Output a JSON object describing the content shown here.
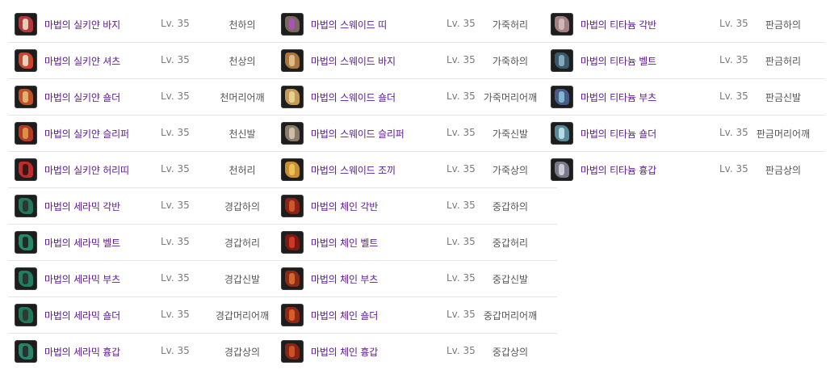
{
  "columns": [
    {
      "items": [
        {
          "name": "마법의 실키얀 바지",
          "level": "Lv. 35",
          "type": "천하의",
          "icon": "silk-pants-icon",
          "color": "#b8353a",
          "accent": "#f0e4d0"
        },
        {
          "name": "마법의 실키얀 셔츠",
          "level": "Lv. 35",
          "type": "천상의",
          "icon": "silk-shirt-icon",
          "color": "#c8462e",
          "accent": "#f1e7d6"
        },
        {
          "name": "마법의 실키얀 숄더",
          "level": "Lv. 35",
          "type": "천머리어깨",
          "icon": "silk-shoulder-icon",
          "color": "#c0502c",
          "accent": "#e9c07a"
        },
        {
          "name": "마법의 실키얀 슬리퍼",
          "level": "Lv. 35",
          "type": "천신발",
          "icon": "silk-slipper-icon",
          "color": "#b43a26",
          "accent": "#e0a050"
        },
        {
          "name": "마법의 실키얀 허리띠",
          "level": "Lv. 35",
          "type": "천허리",
          "icon": "silk-belt-icon",
          "color": "#c22b2b",
          "accent": "#2a1010"
        },
        {
          "name": "마법의 세라믹 각반",
          "level": "Lv. 35",
          "type": "경갑하의",
          "icon": "ceramic-greaves-icon",
          "color": "#1f7a5c",
          "accent": "#2d2d2d"
        },
        {
          "name": "마법의 세라믹 벨트",
          "level": "Lv. 35",
          "type": "경갑허리",
          "icon": "ceramic-belt-icon",
          "color": "#238a68",
          "accent": "#1c1c1c"
        },
        {
          "name": "마법의 세라믹 부츠",
          "level": "Lv. 35",
          "type": "경갑신발",
          "icon": "ceramic-boots-icon",
          "color": "#1f7f60",
          "accent": "#2a2a2a"
        },
        {
          "name": "마법의 세라믹 숄더",
          "level": "Lv. 35",
          "type": "경갑머리어깨",
          "icon": "ceramic-shoulder-icon",
          "color": "#1e7a57",
          "accent": "#303030"
        },
        {
          "name": "마법의 세라믹 흉갑",
          "level": "Lv. 35",
          "type": "경갑상의",
          "icon": "ceramic-breastplate-icon",
          "color": "#25866a",
          "accent": "#262626"
        }
      ]
    },
    {
      "items": [
        {
          "name": "마법의 스웨이드 띠",
          "level": "Lv. 35",
          "type": "가죽허리",
          "icon": "suede-belt-icon",
          "color": "#7a6a5a",
          "accent": "#b050c0"
        },
        {
          "name": "마법의 스웨이드 바지",
          "level": "Lv. 35",
          "type": "가죽하의",
          "icon": "suede-pants-icon",
          "color": "#a8763e",
          "accent": "#e8c890"
        },
        {
          "name": "마법의 스웨이드 숄더",
          "level": "Lv. 35",
          "type": "가죽머리어깨",
          "icon": "suede-shoulder-icon",
          "color": "#c49a55",
          "accent": "#f0d8a0"
        },
        {
          "name": "마법의 스웨이드 슬리퍼",
          "level": "Lv. 35",
          "type": "가죽신발",
          "icon": "suede-slipper-icon",
          "color": "#8a7a6a",
          "accent": "#d8c8b0"
        },
        {
          "name": "마법의 스웨이드 조끼",
          "level": "Lv. 35",
          "type": "가죽상의",
          "icon": "suede-vest-icon",
          "color": "#c8902e",
          "accent": "#f0c860"
        },
        {
          "name": "마법의 체인 각반",
          "level": "Lv. 35",
          "type": "중갑하의",
          "icon": "chain-greaves-icon",
          "color": "#8a2418",
          "accent": "#d86030"
        },
        {
          "name": "마법의 체인 벨트",
          "level": "Lv. 35",
          "type": "중갑허리",
          "icon": "chain-belt-icon",
          "color": "#7a1a14",
          "accent": "#d84028"
        },
        {
          "name": "마법의 체인 부츠",
          "level": "Lv. 35",
          "type": "중갑신발",
          "icon": "chain-boots-icon",
          "color": "#8c2a18",
          "accent": "#e07030"
        },
        {
          "name": "마법의 체인 숄더",
          "level": "Lv. 35",
          "type": "중갑머리어깨",
          "icon": "chain-shoulder-icon",
          "color": "#902818",
          "accent": "#e06a2c"
        },
        {
          "name": "마법의 체인 흉갑",
          "level": "Lv. 35",
          "type": "중갑상의",
          "icon": "chain-breastplate-icon",
          "color": "#862418",
          "accent": "#d85a28"
        }
      ]
    },
    {
      "items": [
        {
          "name": "마법의 티타늄 각반",
          "level": "Lv. 35",
          "type": "판금하의",
          "icon": "titanium-greaves-icon",
          "color": "#a08080",
          "accent": "#d8c0c0"
        },
        {
          "name": "마법의 티타늄 벨트",
          "level": "Lv. 35",
          "type": "판금허리",
          "icon": "titanium-belt-icon",
          "color": "#3a5a6a",
          "accent": "#90b8c8"
        },
        {
          "name": "마법의 티타늄 부츠",
          "level": "Lv. 35",
          "type": "판금신발",
          "icon": "titanium-boots-icon",
          "color": "#4a5a8a",
          "accent": "#88c8d8"
        },
        {
          "name": "마법의 티타늄 숄더",
          "level": "Lv. 35",
          "type": "판금머리어깨",
          "icon": "titanium-shoulder-icon",
          "color": "#5a8a9a",
          "accent": "#c8e8f0"
        },
        {
          "name": "마법의 티타늄 흉갑",
          "level": "Lv. 35",
          "type": "판금상의",
          "icon": "titanium-breastplate-icon",
          "color": "#7a7a8a",
          "accent": "#d8d8e0"
        }
      ]
    }
  ]
}
